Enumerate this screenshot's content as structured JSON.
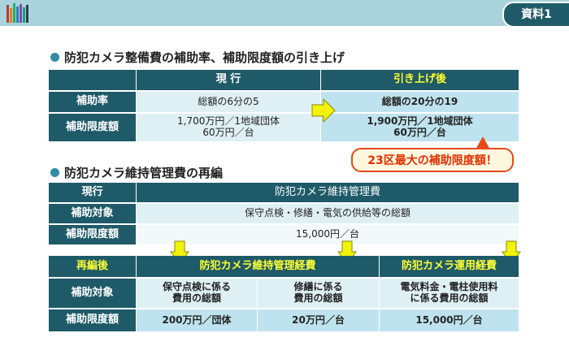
{
  "badge": "資料1",
  "section1": {
    "title": "防犯カメラ整備費の補助率、補助限度額の引き上げ",
    "header_current": "現 行",
    "header_raised": "引き上げ後",
    "rows": [
      {
        "label": "補助率",
        "current": "総額の6分の5",
        "raised": "総額の20分の19"
      },
      {
        "label": "補助限度額",
        "current_line1": "1,700万円／1地域団体",
        "current_line2": "60万円／台",
        "raised_line1": "1,900万円／1地域団体",
        "raised_line2": "60万円／台"
      }
    ],
    "callout": "23区最大の補助限度額！"
  },
  "section2": {
    "title": "防犯カメラ維持管理費の再編",
    "current_label": "現行",
    "current_header": "防犯カメラ維持管理費",
    "current_rows": [
      {
        "label": "補助対象",
        "value": "保守点検・修繕・電気の供給等の総額"
      },
      {
        "label": "補助限度額",
        "value": "15,000円／台"
      }
    ],
    "reorg_label": "再編後",
    "reorg_header_maint": "防犯カメラ維持管理経費",
    "reorg_header_ops": "防犯カメラ運用経費",
    "reorg_rows": [
      {
        "label": "補助対象",
        "col1_line1": "保守点検に係る",
        "col1_line2": "費用の総額",
        "col2_line1": "修繕に係る",
        "col2_line2": "費用の総額",
        "col3_line1": "電気料金・電柱使用料",
        "col3_line2": "に係る費用の総額"
      },
      {
        "label": "補助限度額",
        "col1": "200万円／団体",
        "col2": "20万円／台",
        "col3": "15,000円／台"
      }
    ]
  },
  "colors": {
    "header": "#1f5a68",
    "light": "#dff0f5",
    "mid": "#bfe3ee",
    "arrow": "#f2f20a",
    "callout": "#e64a19"
  }
}
